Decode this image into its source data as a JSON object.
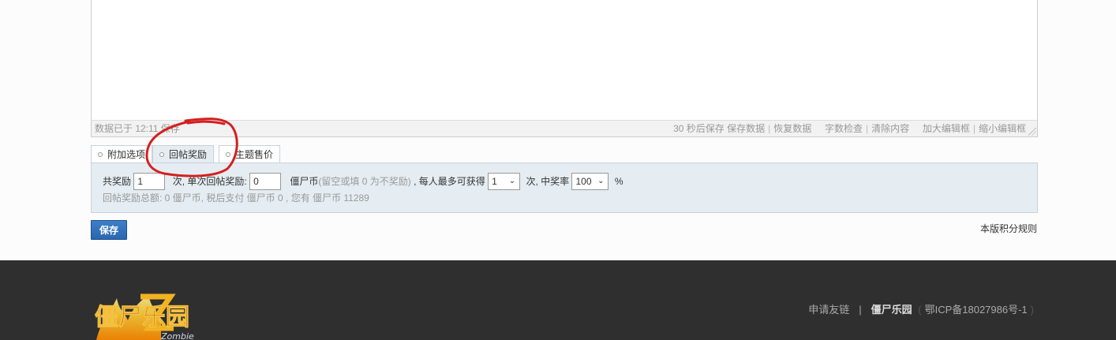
{
  "editor": {
    "status_left": "数据已于 12:11 保存",
    "status_right": {
      "autosave": "30 秒后保存",
      "save_data": "保存数据",
      "restore_data": "恢复数据",
      "word_check": "字数检查",
      "clear_content": "清除内容",
      "enlarge": "加大编辑框",
      "shrink": "缩小编辑框",
      "sep": "|"
    }
  },
  "tabs": [
    {
      "label": "附加选项",
      "active": false
    },
    {
      "label": "回帖奖励",
      "active": true
    },
    {
      "label": "主题售价",
      "active": false
    }
  ],
  "reward": {
    "total_label": "共奖励",
    "total_value": "1",
    "times_single_label": "次, 单次回帖奖励:",
    "single_value": "0",
    "currency_label": "僵尸币",
    "currency_hint": "(留空或填 0 为不奖励)",
    "max_label": ", 每人最多可获得",
    "max_value": "1",
    "rate_label": "次, 中奖率",
    "rate_value": "100",
    "percent": "%",
    "summary": "回帖奖励总额: 0 僵尸币, 税后支付 僵尸币 0 , 您有 僵尸币 11289"
  },
  "save_button": "保存",
  "rules_link": "本版积分规则",
  "footer": {
    "apply_link": "申请友链",
    "sep": "|",
    "brand": "僵尸乐园",
    "paren_open": "(",
    "icp": "鄂ICP备18027986号-1",
    "paren_close": ")",
    "logo_text": "僵尸乐园",
    "logo_sub": "Zombie"
  },
  "colors": {
    "footer_bg": "#2f2f2f",
    "panel_bg": "#e5edf2",
    "button_bg": "#2a66b0",
    "annotation": "#d42020"
  }
}
